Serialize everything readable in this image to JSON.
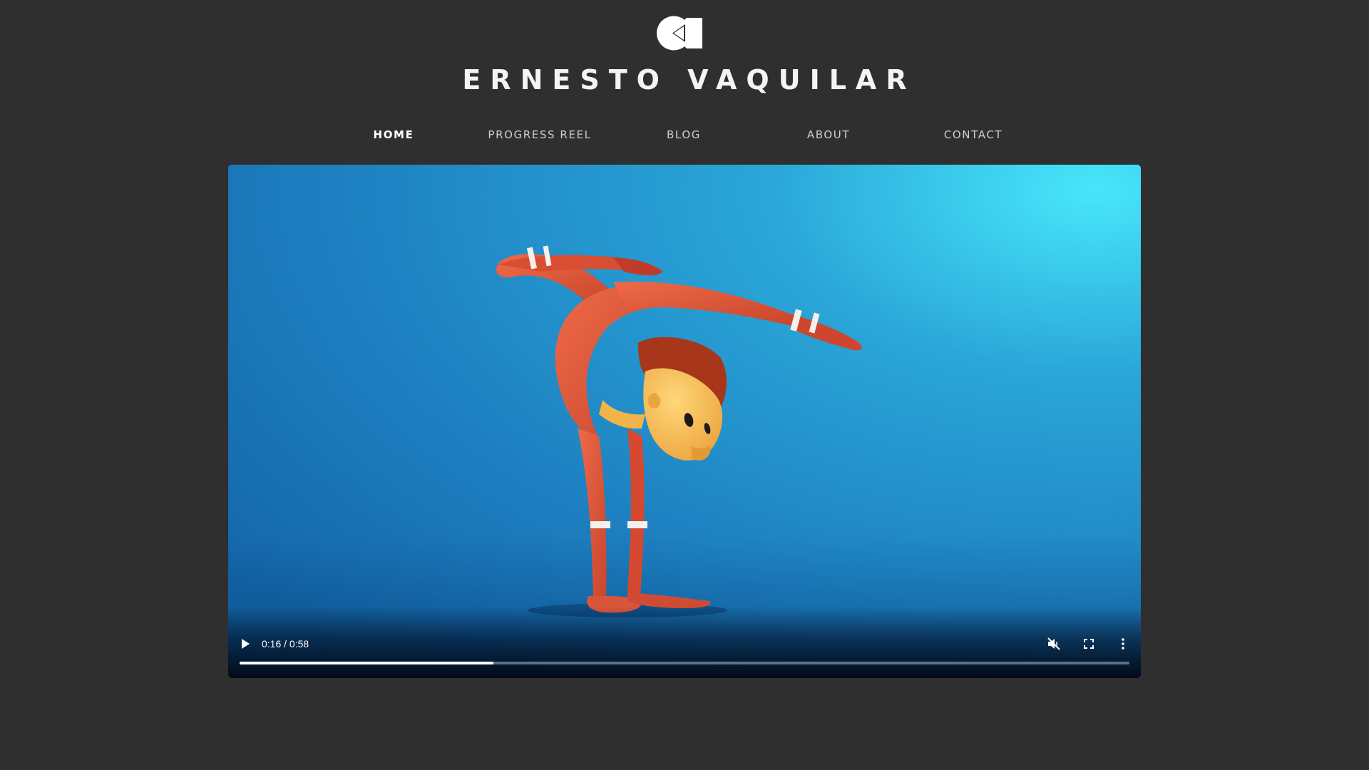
{
  "header": {
    "logo_icon": "camera-play-logo-icon",
    "title": "ERNESTO VAQUILAR"
  },
  "nav": {
    "items": [
      {
        "label": "HOME",
        "active": true
      },
      {
        "label": "PROGRESS REEL",
        "active": false
      },
      {
        "label": "BLOG",
        "active": false
      },
      {
        "label": "ABOUT",
        "active": false
      },
      {
        "label": "CONTACT",
        "active": false
      }
    ]
  },
  "video": {
    "scene": "animated-acrobat-character-handstand",
    "play_icon": "play-icon",
    "time": "0:16 / 0:58",
    "progress": 0.285,
    "mute_icon": "muted-speaker-icon",
    "fullscreen_icon": "fullscreen-icon",
    "more_icon": "more-vertical-icon"
  },
  "colors": {
    "background": "#2f2f2f",
    "title": "#f4f4f4",
    "nav_text": "#cfcfcf",
    "nav_active": "#ffffff",
    "video_backdrop": "#1b78b8",
    "character_suit": "#e0573a",
    "character_skin": "#f2b24a",
    "character_hair": "#a8361a"
  }
}
